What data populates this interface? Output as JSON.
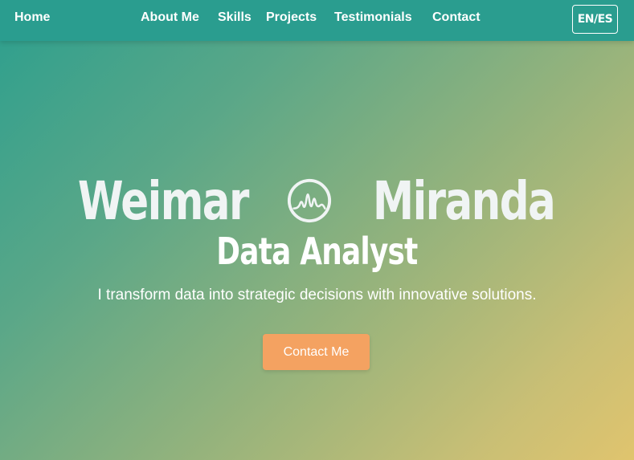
{
  "nav": {
    "home": "Home",
    "about": "About Me",
    "skills": "Skills",
    "projects": "Projects",
    "testimonials": "Testimonials",
    "contact": "Contact",
    "lang_toggle": "EN/ES"
  },
  "hero": {
    "name_first": "Weimar",
    "name_last": "Miranda",
    "logo_icon": "wave-chart-logo-icon",
    "role": "Data Analyst",
    "tagline": "I transform data into strategic decisions with innovative solutions.",
    "cta_label": "Contact Me"
  },
  "colors": {
    "navbar": "#2a9d8f",
    "cta": "#f4a261",
    "gradient_start": "#2c9f8e",
    "gradient_end": "#e0c46e"
  }
}
